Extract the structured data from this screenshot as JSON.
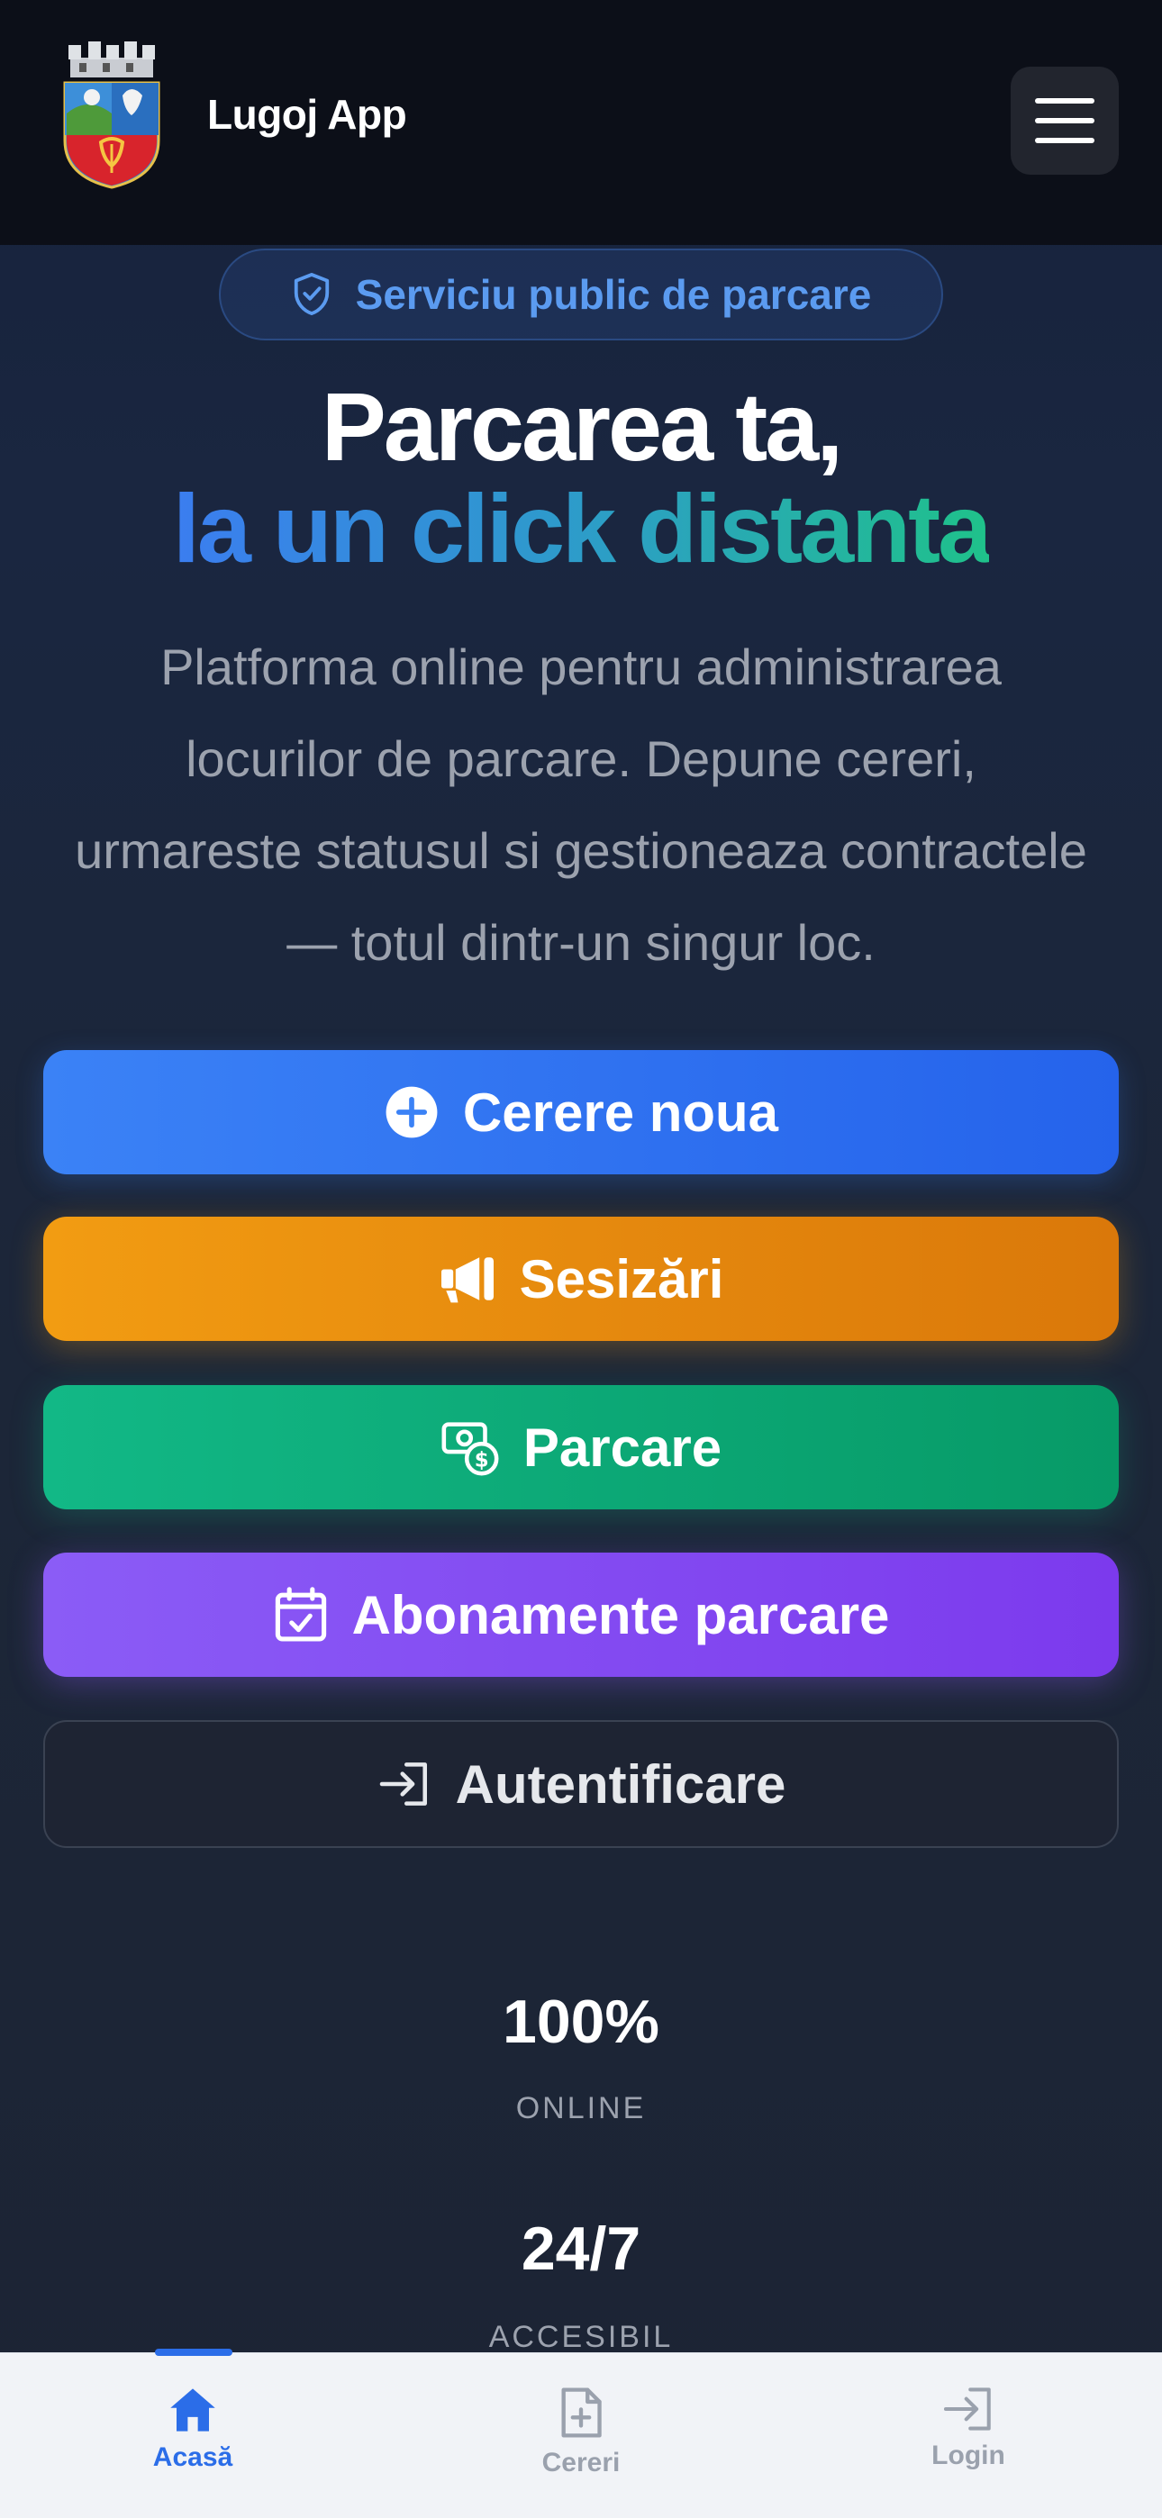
{
  "header": {
    "app_title": "Lugoj App",
    "logo_icon": "lugoj-coat-of-arms",
    "menu_icon": "hamburger-icon"
  },
  "hero": {
    "badge": "Serviciu public de parcare",
    "title_line1": "Parcarea ta,",
    "title_line2": "la un click distanta",
    "description": "Platforma online pentru administrarea locurilor de parcare. Depune cereri, urmareste statusul si gestioneaza contractele — totul dintr-un singur loc."
  },
  "actions": {
    "new_request": "Cerere noua",
    "reports": "Sesizări",
    "parking": "Parcare",
    "subscriptions": "Abonamente parcare",
    "login": "Autentificare"
  },
  "stats": [
    {
      "value": "100%",
      "label": "ONLINE"
    },
    {
      "value": "24/7",
      "label": "ACCESIBIL"
    }
  ],
  "bottom_nav": {
    "home": "Acasă",
    "requests": "Cereri",
    "login": "Login"
  },
  "colors": {
    "primary": "#3b82f6",
    "warning": "#f29c12",
    "success": "#12b886",
    "purple": "#8b5cf6",
    "header_bg": "#0c0f18"
  }
}
